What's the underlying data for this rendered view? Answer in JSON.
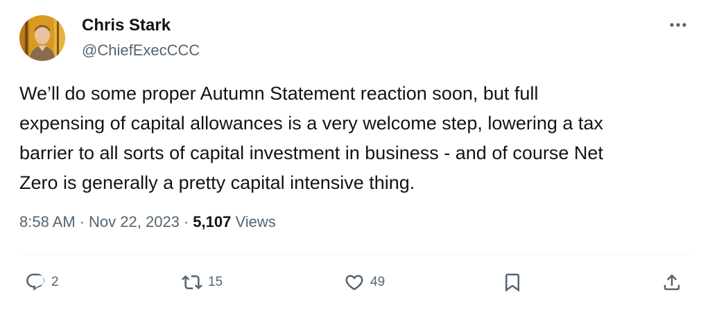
{
  "author": {
    "display_name": "Chris Stark",
    "handle": "@ChiefExecCCC"
  },
  "tweet": {
    "text": "We’ll do some proper Autumn Statement reaction soon, but full\nexpensing of capital allowances is a very welcome step, lowering a tax\nbarrier to all sorts of capital investment in business - and of course Net\nZero is generally a pretty capital intensive thing."
  },
  "meta": {
    "time": "8:58 AM",
    "separator": "·",
    "date": "Nov 22, 2023",
    "views_count": "5,107",
    "views_label": "Views"
  },
  "actions": {
    "replies": "2",
    "retweets": "15",
    "likes": "49"
  },
  "icons": {
    "more": "more-horizontal-icon",
    "reply": "reply-icon",
    "retweet": "retweet-icon",
    "like": "heart-icon",
    "bookmark": "bookmark-icon",
    "share": "share-icon"
  },
  "colors": {
    "text_primary": "#0f1419",
    "text_secondary": "#536471",
    "divider": "#eff3f4",
    "avatar_background": "#e0a21f"
  }
}
